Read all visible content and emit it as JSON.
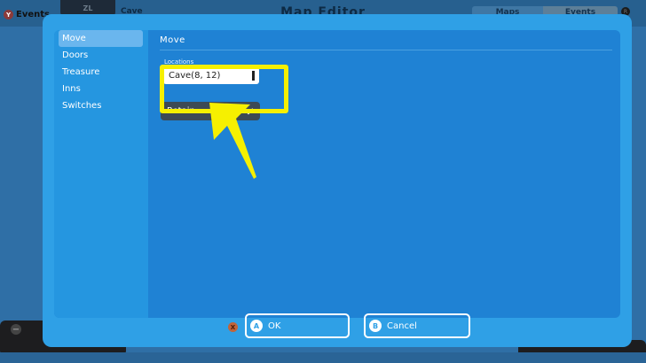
{
  "background": {
    "left_button": "Y",
    "left_label": "Events",
    "zl_label": "ZL",
    "map_name": "Cave",
    "title": "Map Editor",
    "tabs": [
      "Maps",
      "Events"
    ],
    "right_button": "R"
  },
  "dialog": {
    "sidebar": {
      "items": [
        {
          "label": "Move",
          "active": true
        },
        {
          "label": "Doors",
          "active": false
        },
        {
          "label": "Treasure",
          "active": false
        },
        {
          "label": "Inns",
          "active": false
        },
        {
          "label": "Switches",
          "active": false
        }
      ]
    },
    "section_title": "Move",
    "locations": {
      "label": "Locations",
      "value": "Cave(8, 12)"
    },
    "direction": {
      "value": "Retain",
      "icon": "chevron-down-icon"
    },
    "footer": {
      "x_hint": "X",
      "ok_badge": "A",
      "ok_label": "OK",
      "cancel_badge": "B",
      "cancel_label": "Cancel"
    }
  },
  "colors": {
    "highlight": "#f6f000",
    "dialog_bg": "#2fa0e6",
    "panel_bg": "#1f82d4",
    "sidebar_active": "#6ab6ee"
  }
}
